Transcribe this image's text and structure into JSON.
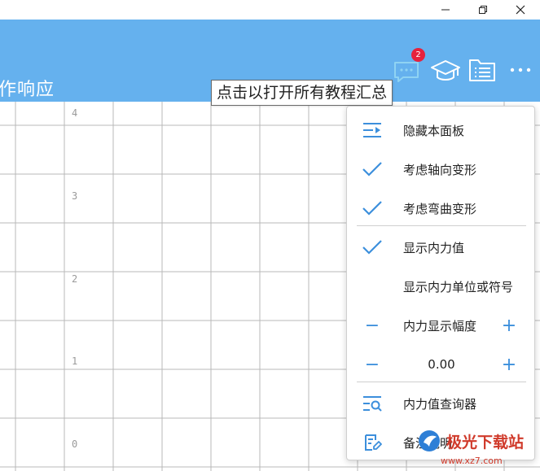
{
  "window": {
    "minimize_icon": "minimize-icon",
    "restore_icon": "restore-icon",
    "close_icon": "close-icon"
  },
  "header": {
    "title": "作响应",
    "notification_count": "2",
    "icons": [
      "message-icon",
      "graduation-cap-icon",
      "list-folder-icon",
      "more-icon"
    ],
    "background": "#65b1ee"
  },
  "tooltip": {
    "text": "点击以打开所有教程汇总"
  },
  "canvas": {
    "y_labels": [
      "4",
      "3",
      "2",
      "1",
      "0"
    ]
  },
  "menu": {
    "accent": "#3c8fdc",
    "items": [
      {
        "label": "隐藏本面板",
        "icon": "hide-panel-icon",
        "checked": false
      },
      {
        "label": "考虑轴向变形",
        "icon": "check-icon",
        "checked": true
      },
      {
        "label": "考虑弯曲变形",
        "icon": "check-icon",
        "checked": true
      },
      {
        "label": "显示内力值",
        "icon": "check-icon",
        "checked": true
      },
      {
        "label": "显示内力单位或符号",
        "icon": "",
        "checked": false
      }
    ],
    "magnitude": {
      "label": "内力显示幅度",
      "minus": "−",
      "plus": "+",
      "value": "0.00"
    },
    "bottom_items": [
      {
        "label": "内力值查询器",
        "icon": "search-list-icon"
      },
      {
        "label": "备注说明",
        "icon": "note-edit-icon"
      }
    ]
  },
  "watermark": {
    "text": "极光下载站",
    "url": "www.xz7.com"
  }
}
